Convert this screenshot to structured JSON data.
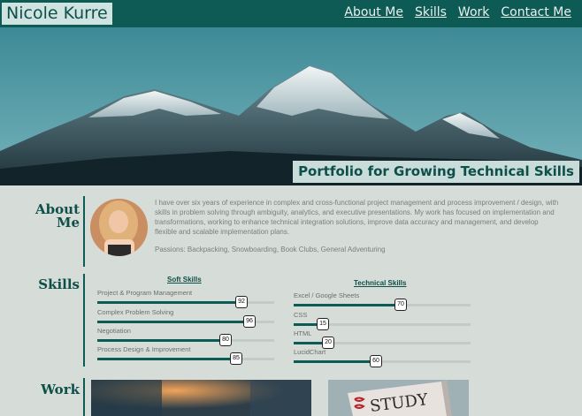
{
  "header": {
    "brand": "Nicole Kurre",
    "nav": [
      "About Me",
      "Skills",
      "Work",
      "Contact Me"
    ]
  },
  "hero": {
    "tagline": "Portfolio for Growing Technical Skills"
  },
  "about": {
    "title_line1": "About",
    "title_line2": "Me",
    "paragraph": "I have over six years of experience in complex and cross-functional project management and process improvement / design, with skills in problem solving through ambiguity, analytics, and executive presentations. My work has focused on implementation and transformations, working to enhance technical integration solutions, improve data accuracy and management, and develop flexible and scalable implementation plans.",
    "passions": "Passions: Backpacking, Snowboarding, Book Clubs, General Adventuring"
  },
  "skills": {
    "title": "Skills",
    "soft_title": "Soft Skills",
    "technical_title": "Technical Skills",
    "soft": [
      {
        "label": "Project & Program Management",
        "value": "92"
      },
      {
        "label": "Complex Problem Solving",
        "value": "96"
      },
      {
        "label": "Negotiation",
        "value": "80"
      },
      {
        "label": "Process Design & Improvement",
        "value": "85"
      }
    ],
    "technical": [
      {
        "label": "Excel / Google Sheets",
        "value": "70"
      },
      {
        "label": "CSS",
        "value": "15"
      },
      {
        "label": "HTML",
        "value": "20"
      },
      {
        "label": "LucidChart",
        "value": "60"
      }
    ]
  },
  "work": {
    "title": "Work",
    "image2_text": "STUDY"
  },
  "colors": {
    "brand": "#0e5a55",
    "background": "#d6dcd7"
  }
}
